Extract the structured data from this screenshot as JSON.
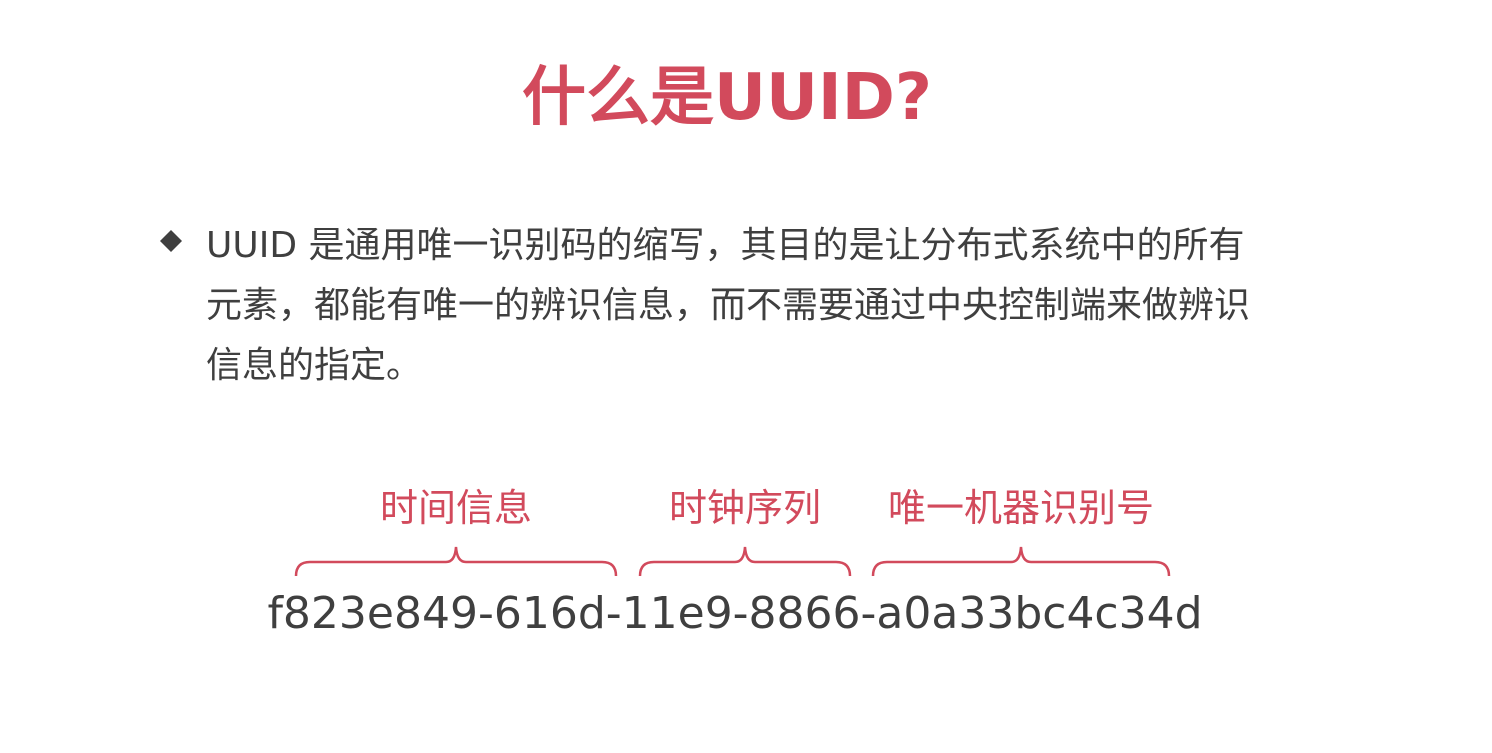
{
  "slide": {
    "title": "什么是UUID?",
    "bullet": {
      "icon": "diamond-bullet-icon",
      "lines": [
        "UUID 是通用唯一识别码的缩写，其目的是让分布式系统中的所有",
        "元素，都能有唯一的辨识信息，而不需要通过中央控制端来做辨识",
        "信息的指定。"
      ]
    },
    "segments": [
      {
        "label": "时间信息"
      },
      {
        "label": "时钟序列"
      },
      {
        "label": "唯一机器识别号"
      }
    ],
    "uuid_example": "f823e849-616d-11e9-8866-a0a33bc4c34d",
    "colors": {
      "accent": "#d24a5c",
      "text": "#3f3f3f",
      "bullet": "#3f3f3f"
    }
  }
}
